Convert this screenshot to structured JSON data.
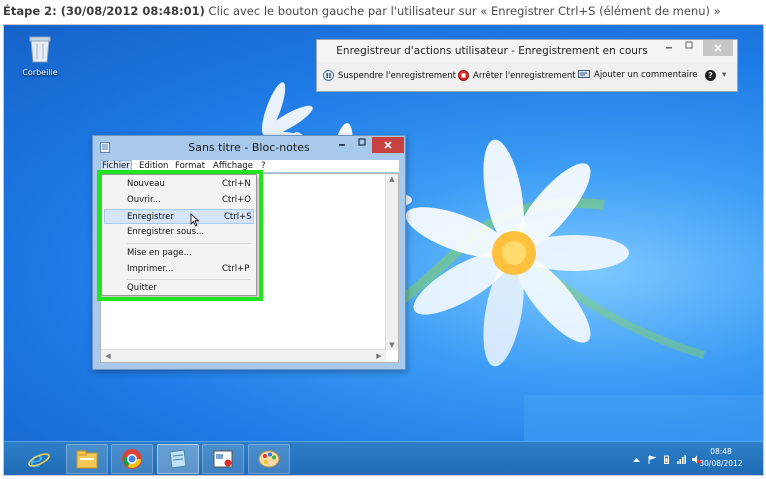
{
  "caption": {
    "step_label": "Étape 2: (30/08/2012 08:48:01)",
    "description": "Clic avec le bouton gauche par l'utilisateur sur « Enregistrer Ctrl+S (élément de menu) »"
  },
  "desktop": {
    "recycle_bin_label": "Corbeille"
  },
  "steps_recorder": {
    "title": "Enregistreur d'actions utilisateur - Enregistrement en cours",
    "pause_label": "Suspendre l'enregistrement",
    "stop_label": "Arrêter l'enregistrement",
    "comment_label": "Ajouter un commentaire",
    "help_glyph": "?",
    "dropdown_glyph": "▾"
  },
  "notepad": {
    "title": "Sans titre - Bloc-notes",
    "menu": [
      "Fichier",
      "Edition",
      "Format",
      "Affichage",
      "?"
    ],
    "file_menu": {
      "items": [
        {
          "label": "Nouveau",
          "shortcut": "Ctrl+N"
        },
        {
          "label": "Ouvrir...",
          "shortcut": "Ctrl+O"
        },
        {
          "label": "Enregistrer",
          "shortcut": "Ctrl+S"
        },
        {
          "label": "Enregistrer sous...",
          "shortcut": ""
        },
        {
          "label": "Mise en page...",
          "shortcut": ""
        },
        {
          "label": "Imprimer...",
          "shortcut": "Ctrl+P"
        },
        {
          "label": "Quitter",
          "shortcut": ""
        }
      ],
      "highlighted": "Enregistrer"
    }
  },
  "taskbar": {
    "apps": [
      "Internet Explorer",
      "Explorateur de fichiers",
      "Google Chrome",
      "Bloc-notes",
      "Enregistreur d'actions utilisateur",
      "Paint"
    ],
    "active_app": "Bloc-notes",
    "clock_time": "08:48",
    "clock_date": "30/08/2012"
  },
  "colors": {
    "highlight_box": "#1ee51e",
    "taskbar": "#1f6bb5",
    "desktop": "#1f7be6"
  }
}
